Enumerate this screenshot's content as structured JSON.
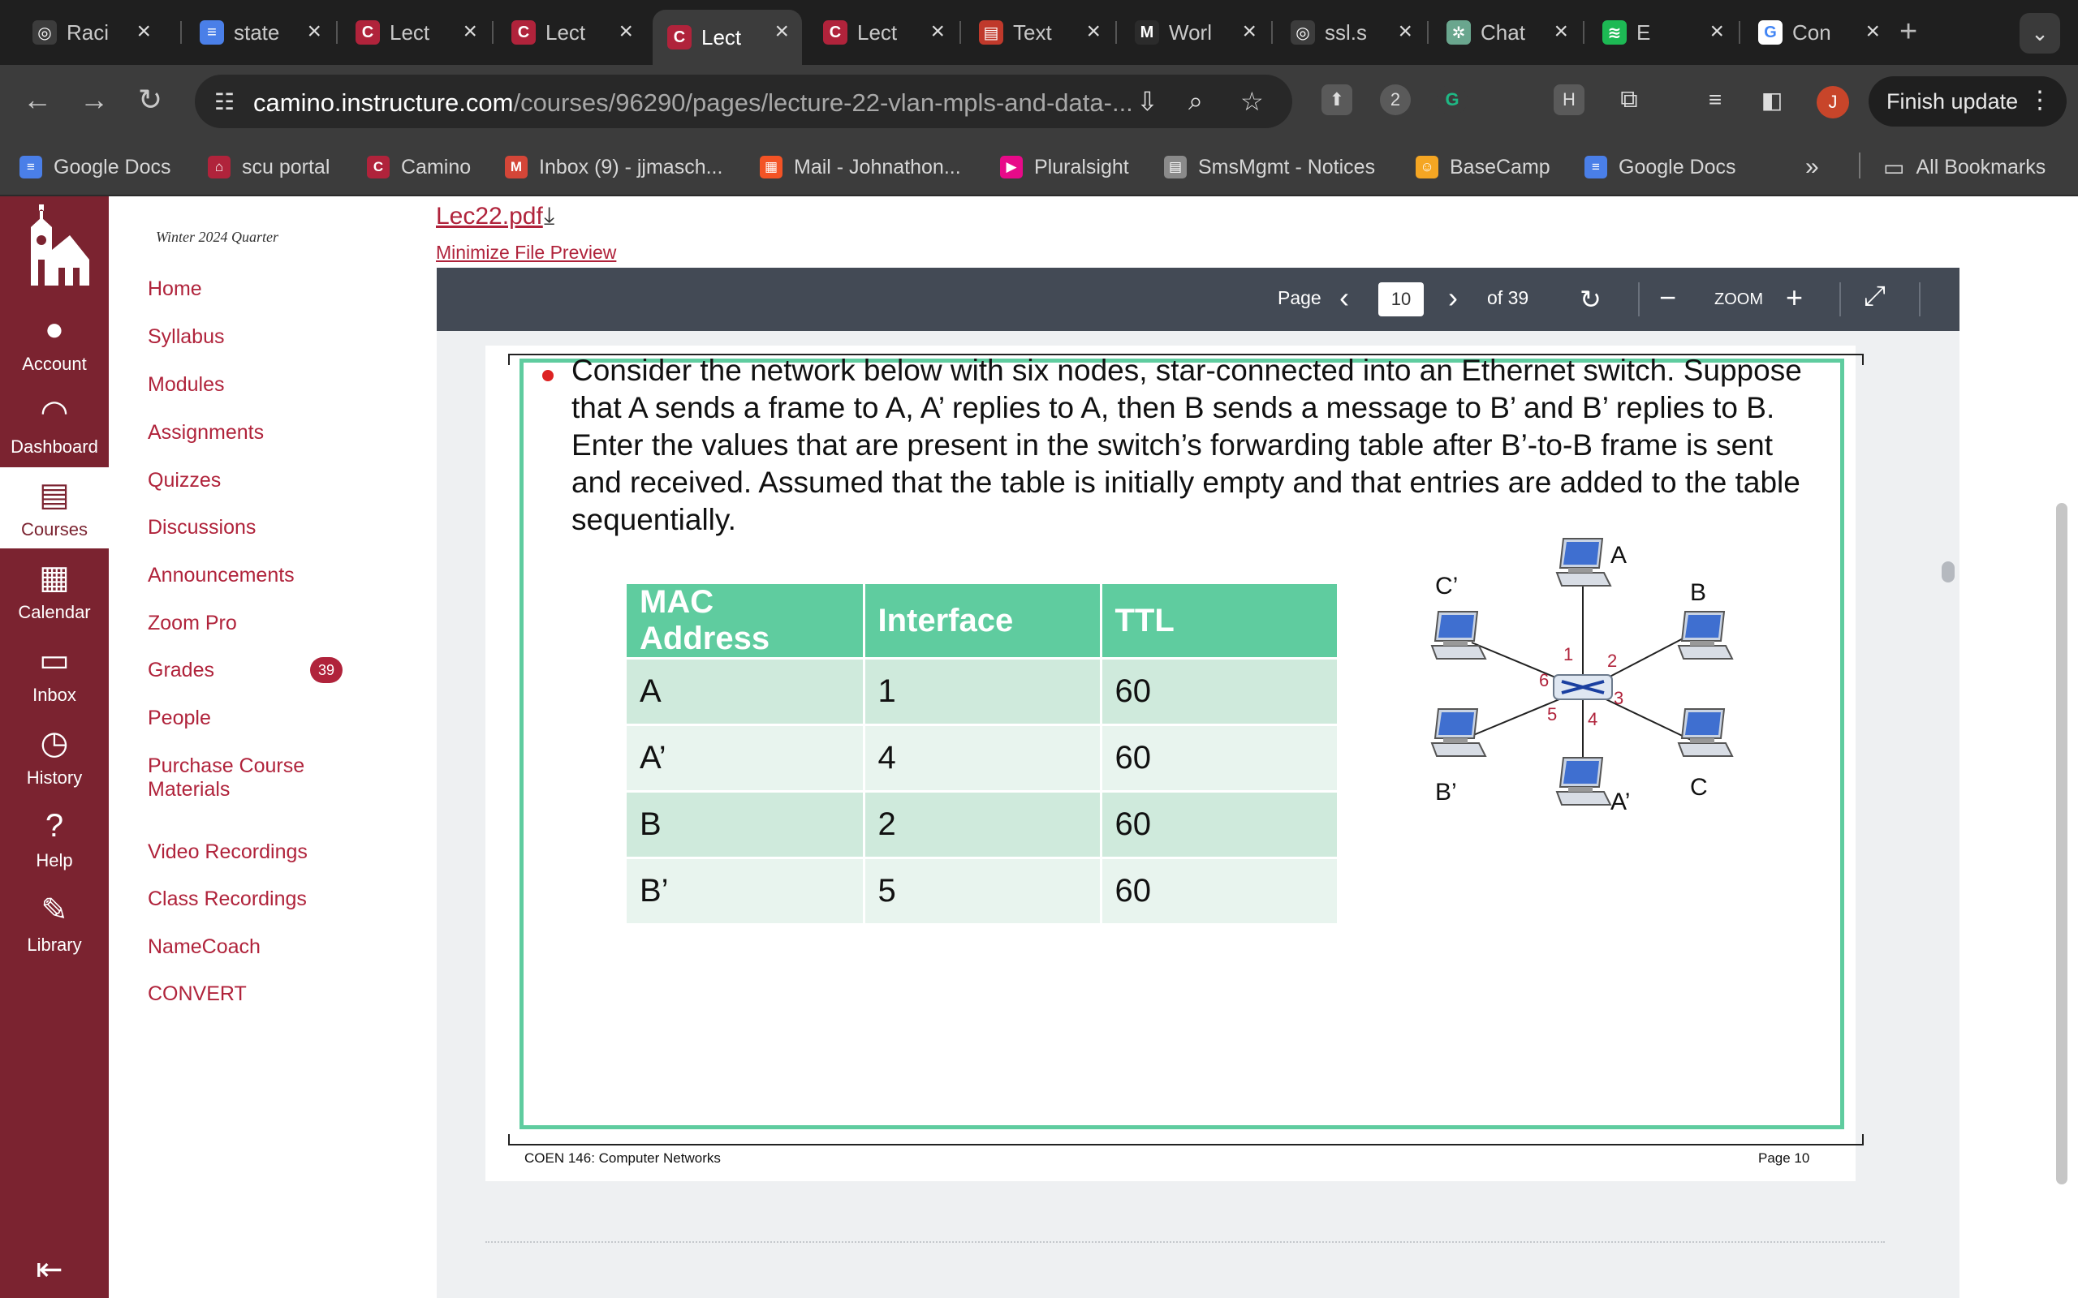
{
  "browser": {
    "tabs": [
      {
        "title": "Raci",
        "icon": "globe-icon",
        "color": "#3c3c3c",
        "glyph": "◎"
      },
      {
        "title": "state",
        "icon": "google-docs-icon",
        "color": "#4a7fe8",
        "glyph": "≡"
      },
      {
        "title": "Lect",
        "icon": "canvas-icon",
        "color": "#b0233b",
        "glyph": "C"
      },
      {
        "title": "Lect",
        "icon": "canvas-icon",
        "color": "#b0233b",
        "glyph": "C"
      },
      {
        "title": "Lect",
        "icon": "canvas-icon",
        "color": "#b0233b",
        "glyph": "C",
        "active": true
      },
      {
        "title": "Lect",
        "icon": "canvas-icon",
        "color": "#b0233b",
        "glyph": "C"
      },
      {
        "title": "Text",
        "icon": "textbook-icon",
        "color": "#c0392b",
        "glyph": "▤"
      },
      {
        "title": "Worl",
        "icon": "medium-icon",
        "color": "#2b2b2b",
        "glyph": "M"
      },
      {
        "title": "ssl.s",
        "icon": "globe-icon",
        "color": "#3c3c3c",
        "glyph": "◎"
      },
      {
        "title": "Chat",
        "icon": "chatgpt-icon",
        "color": "#6aa68e",
        "glyph": "✲"
      },
      {
        "title": "E",
        "icon": "spotify-icon",
        "color": "#1db954",
        "glyph": "≋"
      },
      {
        "title": "Con",
        "icon": "google-icon",
        "color": "#ffffff",
        "glyph": "G"
      }
    ],
    "url_domain": "camino.instructure.com",
    "url_path": "/courses/96290/pages/lecture-22-vlan-mpls-and-data-...",
    "profile_initial": "J",
    "finish_update_label": "Finish update",
    "ext_badge": "2",
    "bookmarks": [
      {
        "label": "Google Docs",
        "icon": "google-docs-icon",
        "color": "#4a7fe8",
        "glyph": "≡"
      },
      {
        "label": "scu portal",
        "icon": "scu-icon",
        "color": "#b0233b",
        "glyph": "⌂"
      },
      {
        "label": "Camino",
        "icon": "canvas-icon",
        "color": "#b0233b",
        "glyph": "C"
      },
      {
        "label": "Inbox (9) - jjmasch...",
        "icon": "gmail-icon",
        "color": "#d44638",
        "glyph": "M"
      },
      {
        "label": "Mail - Johnathon...",
        "icon": "microsoft-icon",
        "color": "#f35325",
        "glyph": "▦"
      },
      {
        "label": "Pluralsight",
        "icon": "pluralsight-icon",
        "color": "#e80a89",
        "glyph": "▶"
      },
      {
        "label": "SmsMgmt - Notices",
        "icon": "document-icon",
        "color": "#8a8a8a",
        "glyph": "▤"
      },
      {
        "label": "BaseCamp",
        "icon": "basecamp-icon",
        "color": "#f5a623",
        "glyph": "☺"
      },
      {
        "label": "Google Docs",
        "icon": "google-docs-icon",
        "color": "#4a7fe8",
        "glyph": "≡"
      }
    ],
    "all_bookmarks_label": "All Bookmarks"
  },
  "global_nav": {
    "items": [
      {
        "label": "Account",
        "icon": "account-icon",
        "glyph": "●"
      },
      {
        "label": "Dashboard",
        "icon": "dashboard-icon",
        "glyph": "◠"
      },
      {
        "label": "Courses",
        "icon": "courses-icon",
        "glyph": "▤",
        "active": true
      },
      {
        "label": "Calendar",
        "icon": "calendar-icon",
        "glyph": "▦"
      },
      {
        "label": "Inbox",
        "icon": "inbox-icon",
        "glyph": "▭"
      },
      {
        "label": "History",
        "icon": "history-icon",
        "glyph": "◷"
      },
      {
        "label": "Help",
        "icon": "help-icon",
        "glyph": "?"
      },
      {
        "label": "Library",
        "icon": "library-icon",
        "glyph": "✎"
      }
    ]
  },
  "course_nav": {
    "term": "Winter 2024 Quarter",
    "items": [
      "Home",
      "Syllabus",
      "Modules",
      "Assignments",
      "Quizzes",
      "Discussions",
      "Announcements",
      "Zoom Pro",
      "Grades",
      "People",
      "Purchase Course Materials",
      "Video Recordings",
      "Class Recordings",
      "NameCoach",
      "CONVERT"
    ],
    "grades_badge": "39"
  },
  "content": {
    "file_name": "Lec22.pdf",
    "minimize_label": "Minimize File Preview"
  },
  "viewer": {
    "page_label": "Page",
    "page_number": "10",
    "page_total": "of 39",
    "zoom_label": "ZOOM"
  },
  "slide": {
    "question": "Consider the network below with six nodes, star-connected into an Ethernet switch. Suppose that A sends a frame to A, A’ replies to A, then B sends a message to B’ and B’ replies to B.  Enter the values that are present in the switch’s forwarding table after B’-to-B frame is sent and received.  Assumed that the table is initially empty and that entries are added to the table sequentially.",
    "table": {
      "headers": [
        "MAC Address",
        "Interface",
        "TTL"
      ],
      "rows": [
        [
          "A",
          "1",
          "60"
        ],
        [
          "A’",
          "4",
          "60"
        ],
        [
          "B",
          "2",
          "60"
        ],
        [
          "B’",
          "5",
          "60"
        ]
      ]
    },
    "diagram": {
      "nodes": [
        "A",
        "B",
        "C",
        "A’",
        "B’",
        "C’"
      ],
      "ports": [
        "1",
        "2",
        "3",
        "4",
        "5",
        "6"
      ]
    },
    "footer_left": "COEN 146: Computer Networks",
    "footer_right": "Page 10"
  }
}
